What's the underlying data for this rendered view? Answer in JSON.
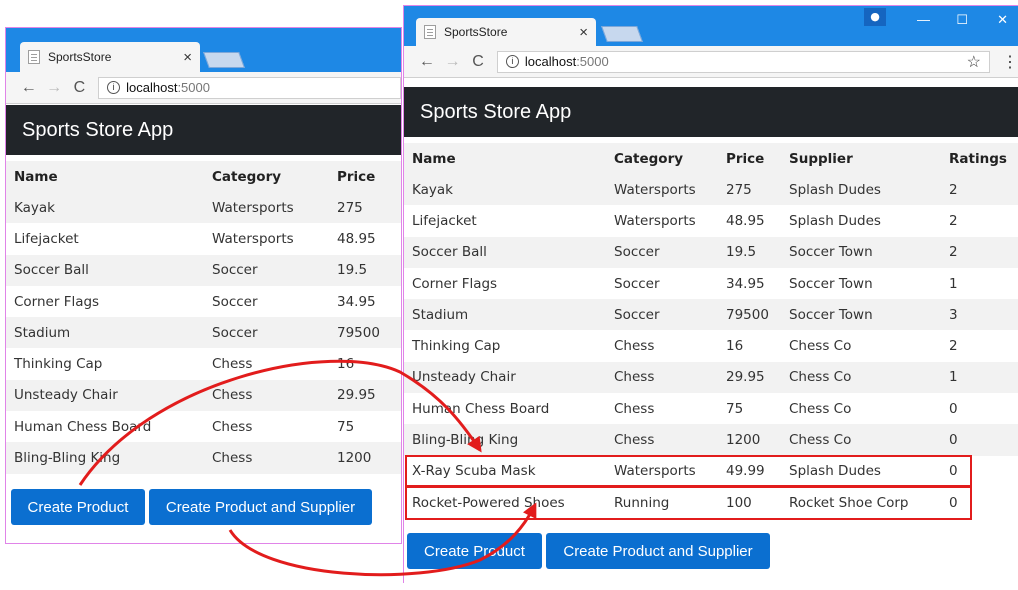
{
  "left_window": {
    "tab_title": "SportsStore",
    "tab_close": "×",
    "url_host": "localhost",
    "url_port": ":5000",
    "app_title": "Sports Store App",
    "columns": [
      "Name",
      "Category",
      "Price"
    ],
    "rows": [
      [
        "Kayak",
        "Watersports",
        "275"
      ],
      [
        "Lifejacket",
        "Watersports",
        "48.95"
      ],
      [
        "Soccer Ball",
        "Soccer",
        "19.5"
      ],
      [
        "Corner Flags",
        "Soccer",
        "34.95"
      ],
      [
        "Stadium",
        "Soccer",
        "79500"
      ],
      [
        "Thinking Cap",
        "Chess",
        "16"
      ],
      [
        "Unsteady Chair",
        "Chess",
        "29.95"
      ],
      [
        "Human Chess Board",
        "Chess",
        "75"
      ],
      [
        "Bling-Bling King",
        "Chess",
        "1200"
      ]
    ],
    "buttons": {
      "create_product": "Create Product",
      "create_product_supplier": "Create Product and Supplier"
    }
  },
  "right_window": {
    "tab_title": "SportsStore",
    "tab_close": "×",
    "url_host": "localhost",
    "url_port": ":5000",
    "app_title": "Sports Store App",
    "columns": [
      "Name",
      "Category",
      "Price",
      "Supplier",
      "Ratings"
    ],
    "rows": [
      [
        "Kayak",
        "Watersports",
        "275",
        "Splash Dudes",
        "2"
      ],
      [
        "Lifejacket",
        "Watersports",
        "48.95",
        "Splash Dudes",
        "2"
      ],
      [
        "Soccer Ball",
        "Soccer",
        "19.5",
        "Soccer Town",
        "2"
      ],
      [
        "Corner Flags",
        "Soccer",
        "34.95",
        "Soccer Town",
        "1"
      ],
      [
        "Stadium",
        "Soccer",
        "79500",
        "Soccer Town",
        "3"
      ],
      [
        "Thinking Cap",
        "Chess",
        "16",
        "Chess Co",
        "2"
      ],
      [
        "Unsteady Chair",
        "Chess",
        "29.95",
        "Chess Co",
        "1"
      ],
      [
        "Human Chess Board",
        "Chess",
        "75",
        "Chess Co",
        "0"
      ],
      [
        "Bling-Bling King",
        "Chess",
        "1200",
        "Chess Co",
        "0"
      ],
      [
        "X-Ray Scuba Mask",
        "Watersports",
        "49.99",
        "Splash Dudes",
        "0"
      ],
      [
        "Rocket-Powered Shoes",
        "Running",
        "100",
        "Rocket Shoe Corp",
        "0"
      ]
    ],
    "buttons": {
      "create_product": "Create Product",
      "create_product_supplier": "Create Product and Supplier"
    }
  },
  "icons": {
    "back": "arrow-left-icon",
    "forward": "arrow-right-icon",
    "reload": "reload-icon",
    "info": "info-icon",
    "star": "star-icon",
    "menu": "kebab-menu-icon"
  },
  "colors": {
    "titlebar": "#1e88e5",
    "appbar": "#212529",
    "button": "#0b6fd0",
    "highlight": "#e21c1c",
    "arrow": "#e21c1c"
  }
}
